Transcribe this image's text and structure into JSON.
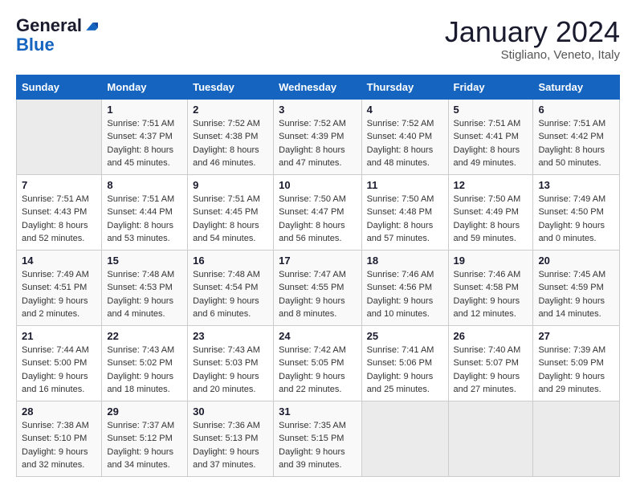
{
  "header": {
    "logo_line1": "General",
    "logo_line2": "Blue",
    "month": "January 2024",
    "location": "Stigliano, Veneto, Italy"
  },
  "weekdays": [
    "Sunday",
    "Monday",
    "Tuesday",
    "Wednesday",
    "Thursday",
    "Friday",
    "Saturday"
  ],
  "weeks": [
    [
      {
        "day": "",
        "sunrise": "",
        "sunset": "",
        "daylight": ""
      },
      {
        "day": "1",
        "sunrise": "Sunrise: 7:51 AM",
        "sunset": "Sunset: 4:37 PM",
        "daylight": "Daylight: 8 hours and 45 minutes."
      },
      {
        "day": "2",
        "sunrise": "Sunrise: 7:52 AM",
        "sunset": "Sunset: 4:38 PM",
        "daylight": "Daylight: 8 hours and 46 minutes."
      },
      {
        "day": "3",
        "sunrise": "Sunrise: 7:52 AM",
        "sunset": "Sunset: 4:39 PM",
        "daylight": "Daylight: 8 hours and 47 minutes."
      },
      {
        "day": "4",
        "sunrise": "Sunrise: 7:52 AM",
        "sunset": "Sunset: 4:40 PM",
        "daylight": "Daylight: 8 hours and 48 minutes."
      },
      {
        "day": "5",
        "sunrise": "Sunrise: 7:51 AM",
        "sunset": "Sunset: 4:41 PM",
        "daylight": "Daylight: 8 hours and 49 minutes."
      },
      {
        "day": "6",
        "sunrise": "Sunrise: 7:51 AM",
        "sunset": "Sunset: 4:42 PM",
        "daylight": "Daylight: 8 hours and 50 minutes."
      }
    ],
    [
      {
        "day": "7",
        "sunrise": "Sunrise: 7:51 AM",
        "sunset": "Sunset: 4:43 PM",
        "daylight": "Daylight: 8 hours and 52 minutes."
      },
      {
        "day": "8",
        "sunrise": "Sunrise: 7:51 AM",
        "sunset": "Sunset: 4:44 PM",
        "daylight": "Daylight: 8 hours and 53 minutes."
      },
      {
        "day": "9",
        "sunrise": "Sunrise: 7:51 AM",
        "sunset": "Sunset: 4:45 PM",
        "daylight": "Daylight: 8 hours and 54 minutes."
      },
      {
        "day": "10",
        "sunrise": "Sunrise: 7:50 AM",
        "sunset": "Sunset: 4:47 PM",
        "daylight": "Daylight: 8 hours and 56 minutes."
      },
      {
        "day": "11",
        "sunrise": "Sunrise: 7:50 AM",
        "sunset": "Sunset: 4:48 PM",
        "daylight": "Daylight: 8 hours and 57 minutes."
      },
      {
        "day": "12",
        "sunrise": "Sunrise: 7:50 AM",
        "sunset": "Sunset: 4:49 PM",
        "daylight": "Daylight: 8 hours and 59 minutes."
      },
      {
        "day": "13",
        "sunrise": "Sunrise: 7:49 AM",
        "sunset": "Sunset: 4:50 PM",
        "daylight": "Daylight: 9 hours and 0 minutes."
      }
    ],
    [
      {
        "day": "14",
        "sunrise": "Sunrise: 7:49 AM",
        "sunset": "Sunset: 4:51 PM",
        "daylight": "Daylight: 9 hours and 2 minutes."
      },
      {
        "day": "15",
        "sunrise": "Sunrise: 7:48 AM",
        "sunset": "Sunset: 4:53 PM",
        "daylight": "Daylight: 9 hours and 4 minutes."
      },
      {
        "day": "16",
        "sunrise": "Sunrise: 7:48 AM",
        "sunset": "Sunset: 4:54 PM",
        "daylight": "Daylight: 9 hours and 6 minutes."
      },
      {
        "day": "17",
        "sunrise": "Sunrise: 7:47 AM",
        "sunset": "Sunset: 4:55 PM",
        "daylight": "Daylight: 9 hours and 8 minutes."
      },
      {
        "day": "18",
        "sunrise": "Sunrise: 7:46 AM",
        "sunset": "Sunset: 4:56 PM",
        "daylight": "Daylight: 9 hours and 10 minutes."
      },
      {
        "day": "19",
        "sunrise": "Sunrise: 7:46 AM",
        "sunset": "Sunset: 4:58 PM",
        "daylight": "Daylight: 9 hours and 12 minutes."
      },
      {
        "day": "20",
        "sunrise": "Sunrise: 7:45 AM",
        "sunset": "Sunset: 4:59 PM",
        "daylight": "Daylight: 9 hours and 14 minutes."
      }
    ],
    [
      {
        "day": "21",
        "sunrise": "Sunrise: 7:44 AM",
        "sunset": "Sunset: 5:00 PM",
        "daylight": "Daylight: 9 hours and 16 minutes."
      },
      {
        "day": "22",
        "sunrise": "Sunrise: 7:43 AM",
        "sunset": "Sunset: 5:02 PM",
        "daylight": "Daylight: 9 hours and 18 minutes."
      },
      {
        "day": "23",
        "sunrise": "Sunrise: 7:43 AM",
        "sunset": "Sunset: 5:03 PM",
        "daylight": "Daylight: 9 hours and 20 minutes."
      },
      {
        "day": "24",
        "sunrise": "Sunrise: 7:42 AM",
        "sunset": "Sunset: 5:05 PM",
        "daylight": "Daylight: 9 hours and 22 minutes."
      },
      {
        "day": "25",
        "sunrise": "Sunrise: 7:41 AM",
        "sunset": "Sunset: 5:06 PM",
        "daylight": "Daylight: 9 hours and 25 minutes."
      },
      {
        "day": "26",
        "sunrise": "Sunrise: 7:40 AM",
        "sunset": "Sunset: 5:07 PM",
        "daylight": "Daylight: 9 hours and 27 minutes."
      },
      {
        "day": "27",
        "sunrise": "Sunrise: 7:39 AM",
        "sunset": "Sunset: 5:09 PM",
        "daylight": "Daylight: 9 hours and 29 minutes."
      }
    ],
    [
      {
        "day": "28",
        "sunrise": "Sunrise: 7:38 AM",
        "sunset": "Sunset: 5:10 PM",
        "daylight": "Daylight: 9 hours and 32 minutes."
      },
      {
        "day": "29",
        "sunrise": "Sunrise: 7:37 AM",
        "sunset": "Sunset: 5:12 PM",
        "daylight": "Daylight: 9 hours and 34 minutes."
      },
      {
        "day": "30",
        "sunrise": "Sunrise: 7:36 AM",
        "sunset": "Sunset: 5:13 PM",
        "daylight": "Daylight: 9 hours and 37 minutes."
      },
      {
        "day": "31",
        "sunrise": "Sunrise: 7:35 AM",
        "sunset": "Sunset: 5:15 PM",
        "daylight": "Daylight: 9 hours and 39 minutes."
      },
      {
        "day": "",
        "sunrise": "",
        "sunset": "",
        "daylight": ""
      },
      {
        "day": "",
        "sunrise": "",
        "sunset": "",
        "daylight": ""
      },
      {
        "day": "",
        "sunrise": "",
        "sunset": "",
        "daylight": ""
      }
    ]
  ]
}
